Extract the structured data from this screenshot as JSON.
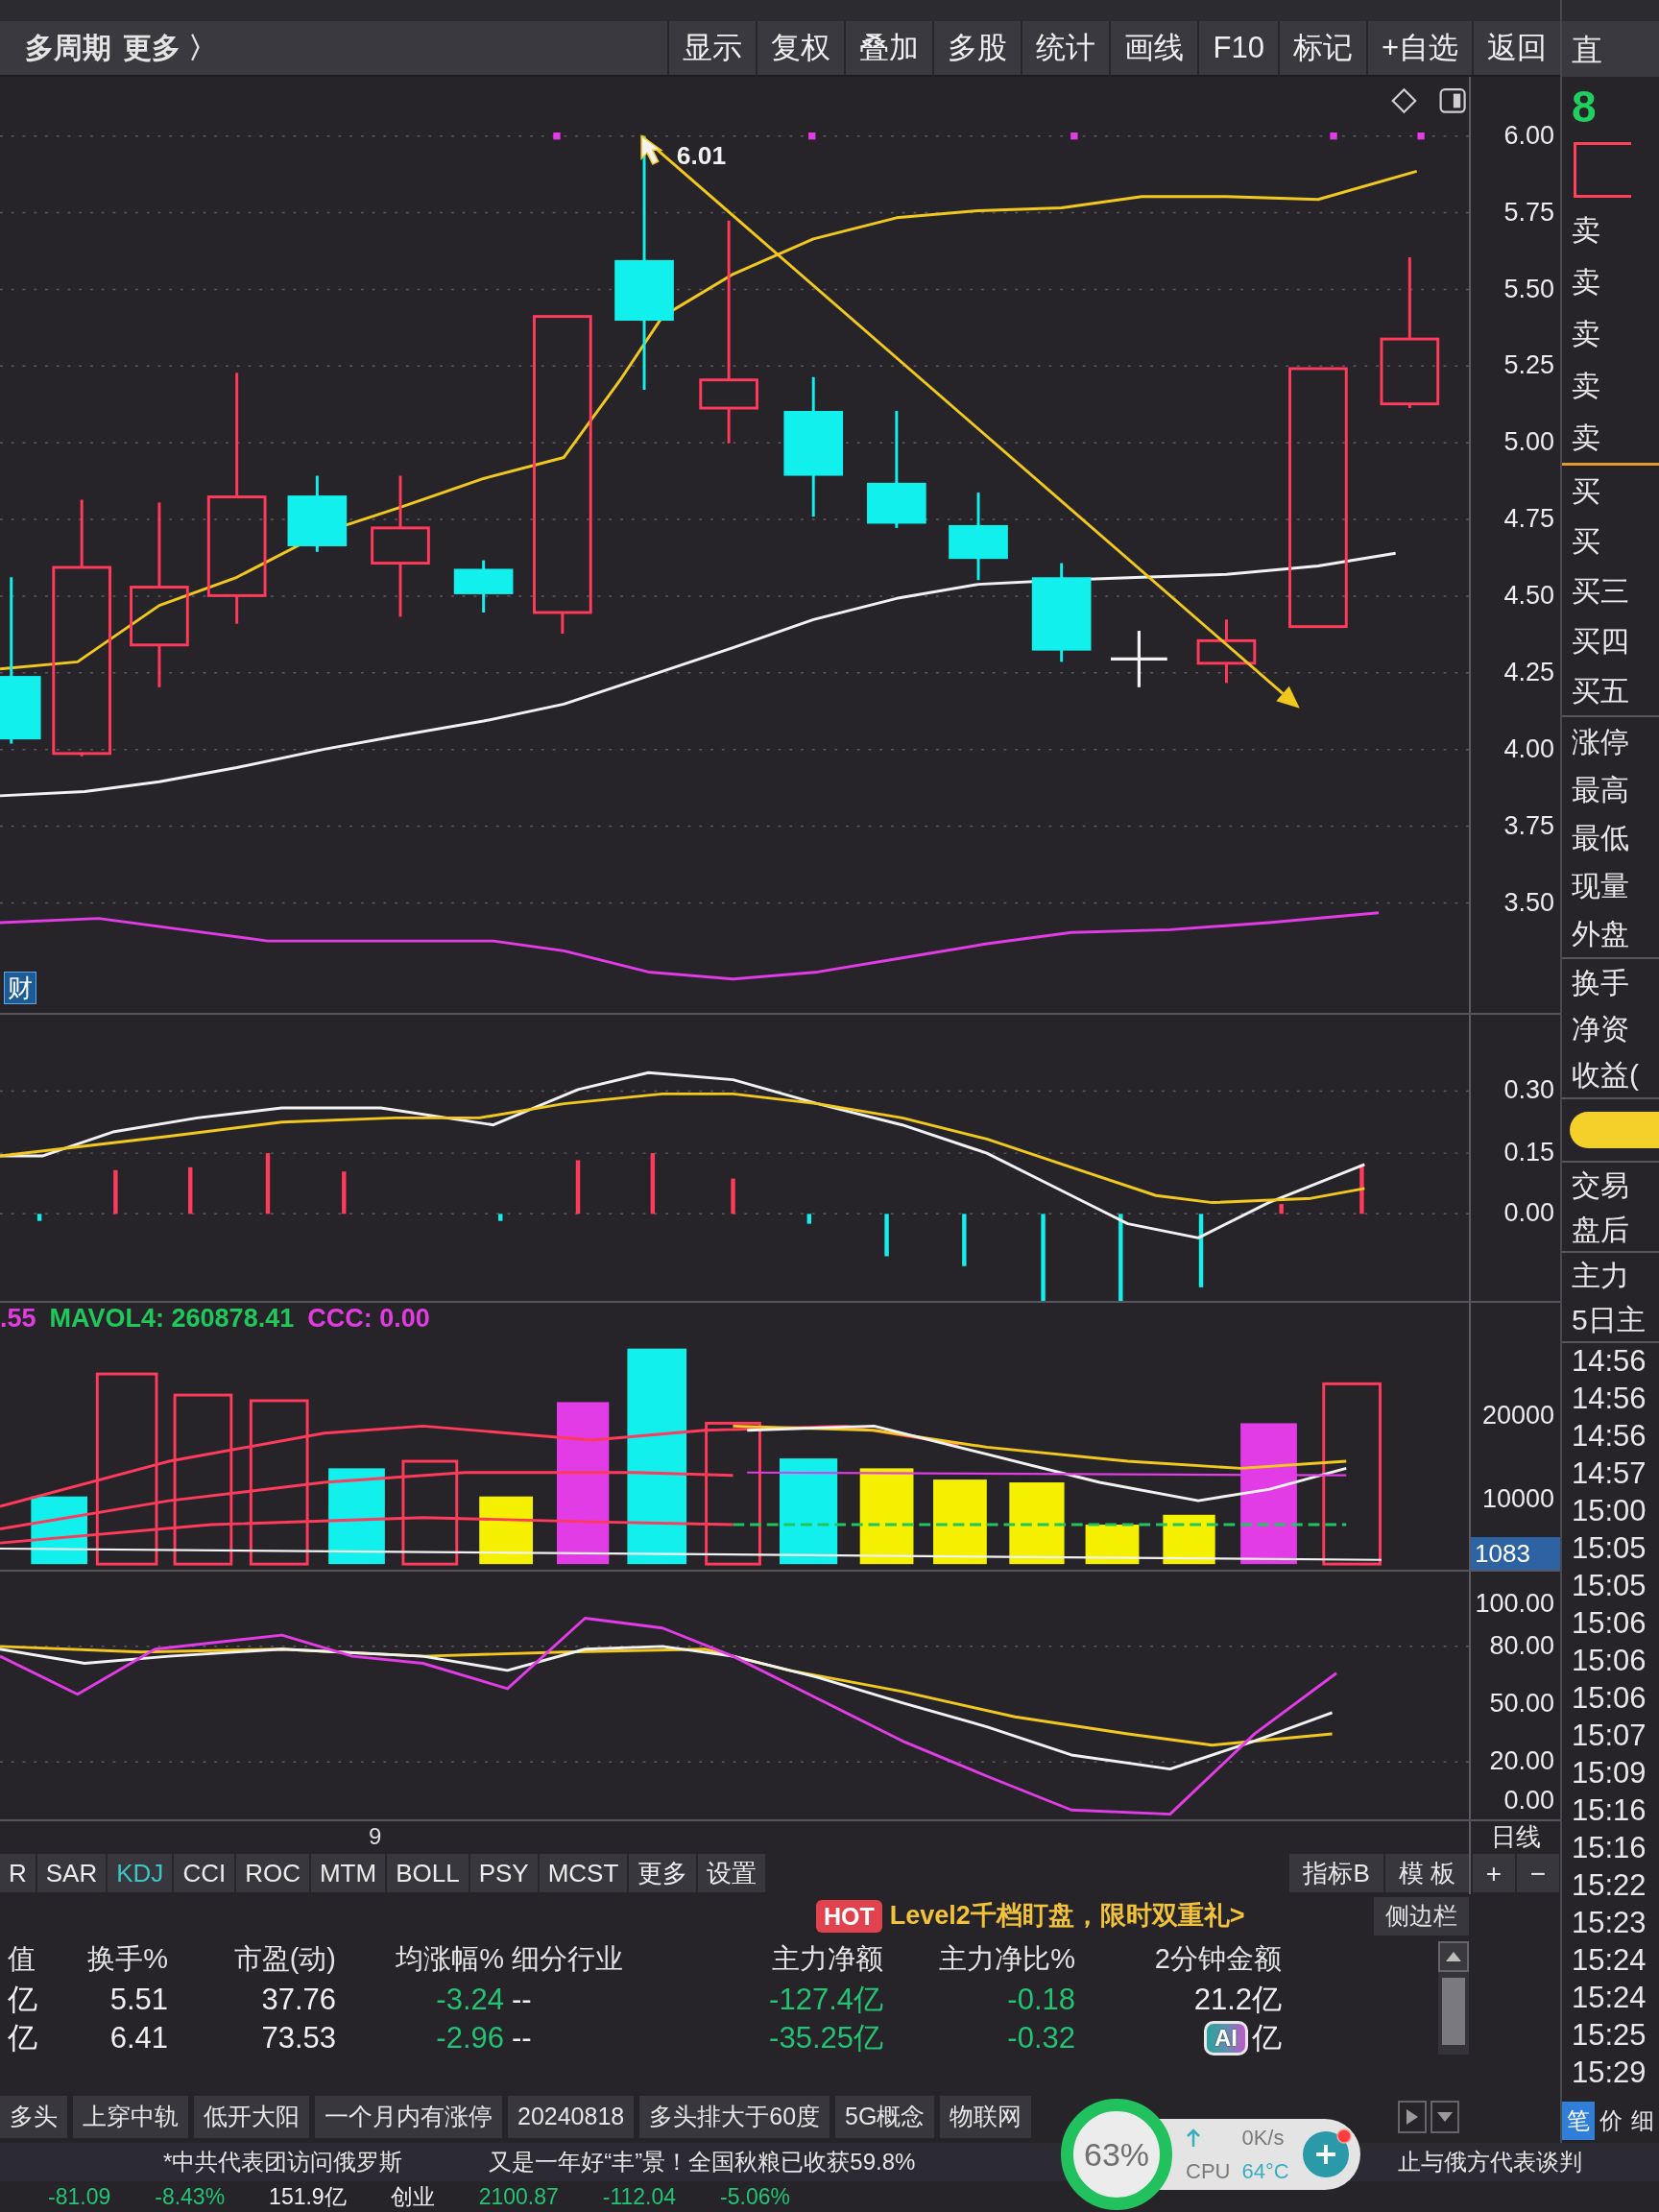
{
  "toolbar": {
    "links": [
      "多周期",
      "更多 〉"
    ],
    "buttons": [
      "显示",
      "复权",
      "叠加",
      "多股",
      "统计",
      "画线",
      "F10",
      "标记",
      "+自选",
      "返回"
    ]
  },
  "price_chart": {
    "high_label": "6.01",
    "axis_labels": [
      "6.00",
      "5.75",
      "5.50",
      "5.25",
      "5.00",
      "4.75",
      "4.50",
      "4.25",
      "4.00",
      "3.75",
      "3.50"
    ],
    "badge": "财"
  },
  "macd_chart": {
    "axis_labels": [
      "0.30",
      "0.15",
      "0.00"
    ]
  },
  "volume_chart": {
    "legend": [
      {
        "text": ".55",
        "color": "#e03ce0"
      },
      {
        "text": "MAVOL4: 260878.41",
        "color": "#1fc85a"
      },
      {
        "text": "CCC: 0.00",
        "color": "#e03ce0"
      }
    ],
    "axis_labels": [
      "20000",
      "10000"
    ],
    "current_value": "1083"
  },
  "kdj_chart": {
    "axis_labels": [
      "100.00",
      "80.00",
      "50.00",
      "20.00",
      "0.00"
    ],
    "date_label": "9"
  },
  "period_button": "日线",
  "indicator_bar": {
    "tabs": [
      {
        "label": "R",
        "selected": false
      },
      {
        "label": "SAR",
        "selected": false
      },
      {
        "label": "KDJ",
        "selected": true
      },
      {
        "label": "CCI",
        "selected": false
      },
      {
        "label": "ROC",
        "selected": false
      },
      {
        "label": "MTM",
        "selected": false
      },
      {
        "label": "BOLL",
        "selected": false
      },
      {
        "label": "PSY",
        "selected": false
      },
      {
        "label": "MCST",
        "selected": false
      },
      {
        "label": "更多",
        "selected": false
      },
      {
        "label": "设置",
        "selected": false
      }
    ],
    "tools": [
      "指标B",
      "模 板"
    ],
    "zoom_buttons": [
      "+",
      "−"
    ]
  },
  "promo": {
    "badge": "HOT",
    "text": "Level2千档盯盘，限时双重礼>"
  },
  "sidebar_button": "侧边栏",
  "sector_table": {
    "columns": [
      {
        "label": "值",
        "kind": "text"
      },
      {
        "label": "换手%",
        "kind": "plain"
      },
      {
        "label": "市盈(动)",
        "kind": "plain"
      },
      {
        "label": "均涨幅%",
        "kind": "falling"
      },
      {
        "label": "细分行业",
        "kind": "text"
      },
      {
        "label": "主力净额",
        "kind": "falling"
      },
      {
        "label": "主力净比%",
        "kind": "falling"
      },
      {
        "label": "2分钟金额",
        "kind": "plain"
      }
    ],
    "rows": [
      [
        "亿",
        "5.51",
        "37.76",
        "-3.24",
        "--",
        "-127.4亿",
        "-0.18",
        "21.2亿"
      ],
      [
        "亿",
        "6.41",
        "73.53",
        "-2.96",
        "--",
        "-35.25亿",
        "-0.32",
        "亿"
      ]
    ],
    "ai_badge": "AI"
  },
  "tags": [
    "多头",
    "上穿中轨",
    "低开大阳",
    "一个月内有涨停",
    "20240818",
    "多头排大于60度",
    "5G概念",
    "物联网"
  ],
  "news": [
    "*中共代表团访问俄罗斯",
    "又是一年好“丰”景！全国秋粮已收获59.8%",
    "止与俄方代表谈判"
  ],
  "index_bar": [
    {
      "text": "-81.09",
      "kind": "falling"
    },
    {
      "text": "-8.43%",
      "kind": "falling"
    },
    {
      "text": "151.9亿",
      "kind": "plain"
    },
    {
      "text": "创业",
      "kind": "plain"
    },
    {
      "text": "2100.87",
      "kind": "falling"
    },
    {
      "text": "-112.04",
      "kind": "falling"
    },
    {
      "text": "-5.06%",
      "kind": "falling"
    }
  ],
  "side_panel": {
    "title": "直",
    "price": "8",
    "ask_labels": [
      "卖",
      "卖",
      "卖",
      "卖",
      "卖"
    ],
    "bid_labels": [
      "买",
      "买",
      "买三",
      "买四",
      "买五"
    ],
    "stat_labels": [
      "涨停",
      "最高",
      "最低",
      "现量",
      "外盘"
    ],
    "ratio_labels": [
      "换手",
      "净资",
      "收益("
    ],
    "trade_labels": [
      "交易",
      "盘后"
    ],
    "flow_labels": [
      "主力",
      "5日主"
    ],
    "times": [
      "14:56",
      "14:56",
      "14:56",
      "14:57",
      "15:00",
      "15:05",
      "15:05",
      "15:06",
      "15:06",
      "15:06",
      "15:07",
      "15:09",
      "15:16",
      "15:16",
      "15:22",
      "15:23",
      "15:24",
      "15:24",
      "15:25",
      "15:29"
    ],
    "tabs": [
      {
        "label": "笔",
        "selected": true
      },
      {
        "label": "价",
        "selected": false
      },
      {
        "label": "细",
        "selected": false
      }
    ]
  },
  "system_widget": {
    "percent": "63%",
    "speed": "0K/s",
    "cpu_label": "CPU",
    "cpu_temp": "64°C"
  }
}
